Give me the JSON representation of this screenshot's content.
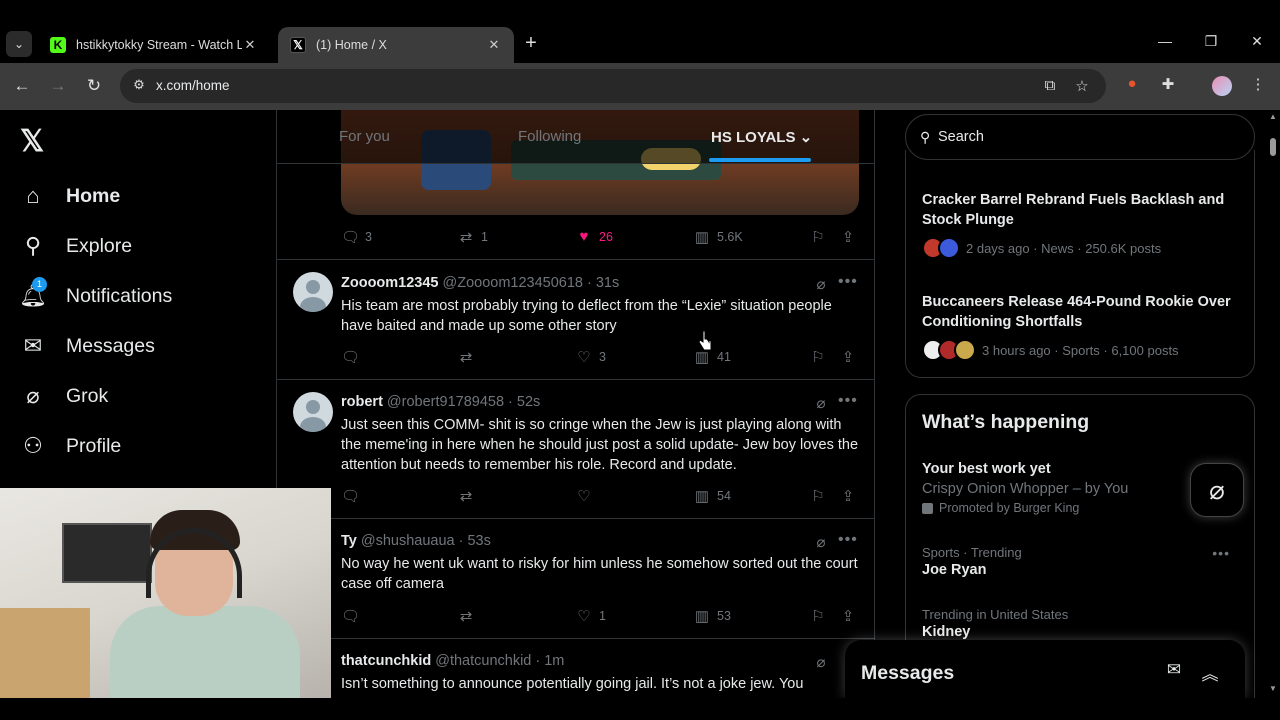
{
  "browser": {
    "tabs": [
      {
        "title": "hstikkytokky Stream - Watch Liv",
        "favicon": "kick-icon",
        "active": false
      },
      {
        "title": "(1) Home / X",
        "favicon": "x-icon",
        "active": true
      }
    ],
    "url": "x.com/home"
  },
  "sidebar": {
    "items": [
      {
        "label": "Home",
        "icon": "home-icon"
      },
      {
        "label": "Explore",
        "icon": "search-icon"
      },
      {
        "label": "Notifications",
        "icon": "bell-icon",
        "badge": "1"
      },
      {
        "label": "Messages",
        "icon": "envelope-icon"
      },
      {
        "label": "Grok",
        "icon": "grok-icon"
      },
      {
        "label": "Profile",
        "icon": "person-icon"
      }
    ]
  },
  "feed": {
    "tabs": [
      "For you",
      "Following",
      "HS LOYALS"
    ],
    "active_tab": "HS LOYALS",
    "top_post_stats": {
      "replies": "3",
      "reposts": "1",
      "likes": "26",
      "views": "5.6K"
    },
    "tweets": [
      {
        "name": "Zoooom12345",
        "handle": "@Zoooom123450618",
        "time": "31s",
        "text": "His team are most probably trying to deflect from the “Lexie” situation people have baited and made up some other story",
        "replies": "",
        "reposts": "",
        "likes": "3",
        "views": "41"
      },
      {
        "name": "robert",
        "handle": "@robert91789458",
        "time": "52s",
        "text": "Just seen this COMM- shit is so cringe when the Jew is just playing along with the meme'ing in here when he should just post a solid update- Jew boy loves the attention but needs to remember his role. Record and update.",
        "replies": "",
        "reposts": "",
        "likes": "",
        "views": "54"
      },
      {
        "name": "Ty",
        "handle": "@shushauaua",
        "time": "53s",
        "text": "No way he went uk want to risky for him unless he somehow sorted out the court case off camera",
        "replies": "",
        "reposts": "",
        "likes": "1",
        "views": "53"
      },
      {
        "name": "thatcunchkid",
        "handle": "@thatcunchkid",
        "time": "1m",
        "text": "Isn’t something to announce potentially going jail. It’s not a joke jew. You",
        "replies": "",
        "reposts": "",
        "likes": "",
        "views": ""
      }
    ]
  },
  "right": {
    "search_placeholder": "Search",
    "news": [
      {
        "title": "Cracker Barrel Rebrand Fuels Backlash and Stock Plunge",
        "meta": "2 days ago · News · 250.6K posts"
      },
      {
        "title": "Buccaneers Release 464-Pound Rookie Over Conditioning Shortfalls",
        "meta": "3 hours ago · Sports · 6,100 posts"
      }
    ],
    "happening_title": "What’s happening",
    "trends": [
      {
        "title": "Your best work yet",
        "sub": "Crispy Onion Whopper – by You",
        "promo": "Promoted by Burger King"
      },
      {
        "context": "Sports · Trending",
        "title": "Joe Ryan"
      },
      {
        "context": "Trending in United States",
        "title": "Kidney"
      }
    ]
  },
  "messages_drawer": {
    "title": "Messages"
  },
  "colors": {
    "accent": "#1d9bf0",
    "like": "#f91880",
    "muted": "#71767b"
  }
}
